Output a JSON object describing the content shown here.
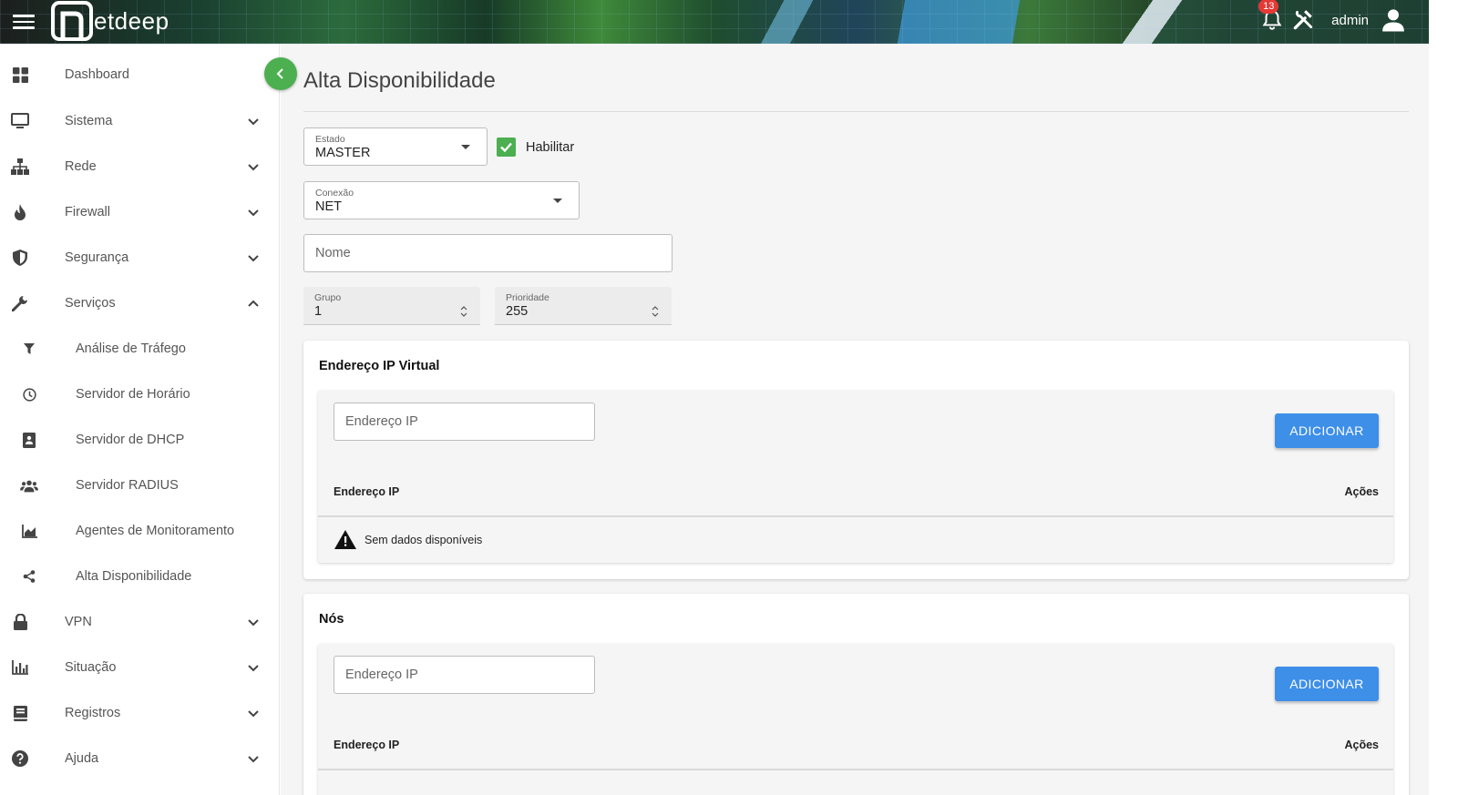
{
  "header": {
    "logo_letter": "n",
    "logo_text": "etdeep",
    "notification_count": "13",
    "user_name": "admin"
  },
  "sidebar": {
    "items": [
      {
        "label": "Dashboard",
        "icon": "dashboard-icon",
        "expandable": false
      },
      {
        "label": "Sistema",
        "icon": "monitor-icon",
        "expandable": true
      },
      {
        "label": "Rede",
        "icon": "network-icon",
        "expandable": true
      },
      {
        "label": "Firewall",
        "icon": "flame-icon",
        "expandable": true
      },
      {
        "label": "Segurança",
        "icon": "shield-icon",
        "expandable": true
      },
      {
        "label": "Serviços",
        "icon": "wrench-icon",
        "expandable": true,
        "expanded": true
      },
      {
        "label": "VPN",
        "icon": "lock-icon",
        "expandable": true
      },
      {
        "label": "Situação",
        "icon": "bar-chart-icon",
        "expandable": true
      },
      {
        "label": "Registros",
        "icon": "book-icon",
        "expandable": true
      },
      {
        "label": "Ajuda",
        "icon": "help-icon",
        "expandable": true
      }
    ],
    "sub_items": [
      {
        "label": "Análise de Tráfego",
        "icon": "filter-icon"
      },
      {
        "label": "Servidor de Horário",
        "icon": "clock-icon"
      },
      {
        "label": "Servidor de DHCP",
        "icon": "contact-card-icon"
      },
      {
        "label": "Servidor RADIUS",
        "icon": "group-icon"
      },
      {
        "label": "Agentes de Monitoramento",
        "icon": "area-chart-icon"
      },
      {
        "label": "Alta Disponibilidade",
        "icon": "share-icon"
      }
    ]
  },
  "main": {
    "title": "Alta Disponibilidade",
    "estado": {
      "label": "Estado",
      "value": "MASTER"
    },
    "habilitar": {
      "label": "Habilitar",
      "checked": true
    },
    "conexao": {
      "label": "Conexão",
      "value": "NET"
    },
    "nome": {
      "placeholder": "Nome"
    },
    "grupo": {
      "label": "Grupo",
      "value": "1"
    },
    "prioridade": {
      "label": "Prioridade",
      "value": "255"
    },
    "virtual_ip": {
      "title": "Endereço IP Virtual",
      "input_placeholder": "Endereço IP",
      "add_button": "ADICIONAR",
      "columns": [
        "Endereço IP",
        "Ações"
      ],
      "empty_text": "Sem dados disponíveis"
    },
    "nodes": {
      "title": "Nós",
      "input_placeholder": "Endereço IP",
      "add_button": "ADICIONAR",
      "columns": [
        "Endereço IP",
        "Ações"
      ]
    }
  },
  "colors": {
    "accent_green": "#4caf50",
    "button_blue": "#3d8fe8",
    "badge_red": "#e53935"
  }
}
